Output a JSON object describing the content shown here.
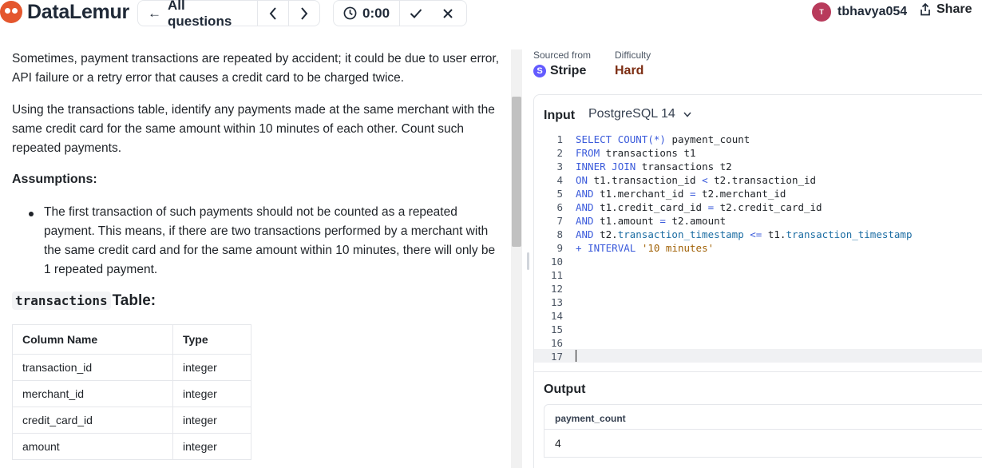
{
  "header": {
    "brand": "DataLemur",
    "all_questions": "All questions",
    "timer": "0:00",
    "username": "tbhavya054",
    "avatar_initial": "T",
    "share": "Share"
  },
  "question": {
    "para1": "Sometimes, payment transactions are repeated by accident; it could be due to user error, API failure or a retry error that causes a credit card to be charged twice.",
    "para2": "Using the transactions table, identify any payments made at the same merchant with the same credit card for the same amount within 10 minutes of each other. Count such repeated payments.",
    "assumptions_title": "Assumptions:",
    "assumption_1": "The first transaction of such payments should not be counted as a repeated payment. This means, if there are two transactions performed by a merchant with the same credit card and for the same amount within 10 minutes, there will only be 1 repeated payment.",
    "table_name": "transactions",
    "table_suffix": " Table:",
    "schema_headers": [
      "Column Name",
      "Type"
    ],
    "schema_rows": [
      [
        "transaction_id",
        "integer"
      ],
      [
        "merchant_id",
        "integer"
      ],
      [
        "credit_card_id",
        "integer"
      ],
      [
        "amount",
        "integer"
      ]
    ]
  },
  "meta": {
    "sourced_label": "Sourced from",
    "sourced_value": "Stripe",
    "difficulty_label": "Difficulty",
    "difficulty_value": "Hard"
  },
  "editor": {
    "input_label": "Input",
    "language": "PostgreSQL 14",
    "line_numbers": [
      "1",
      "2",
      "3",
      "4",
      "5",
      "6",
      "7",
      "8",
      "9",
      "10",
      "11",
      "12",
      "13",
      "14",
      "15",
      "16",
      "17"
    ],
    "lines": [
      "SELECT COUNT(*) payment_count",
      "FROM transactions t1",
      "INNER JOIN transactions t2",
      "ON t1.transaction_id < t2.transaction_id",
      "AND t1.merchant_id = t2.merchant_id",
      "AND t1.credit_card_id = t2.credit_card_id",
      "AND t1.amount = t2.amount",
      "AND t2.transaction_timestamp <= t1.transaction_timestamp",
      "+ INTERVAL '10 minutes'"
    ]
  },
  "output": {
    "label": "Output",
    "column": "payment_count",
    "value": "4"
  },
  "colors": {
    "brand": "#e4572e",
    "difficulty_hard": "#7c2d12",
    "stripe": "#635bff",
    "keyword": "#3b5bdb"
  }
}
